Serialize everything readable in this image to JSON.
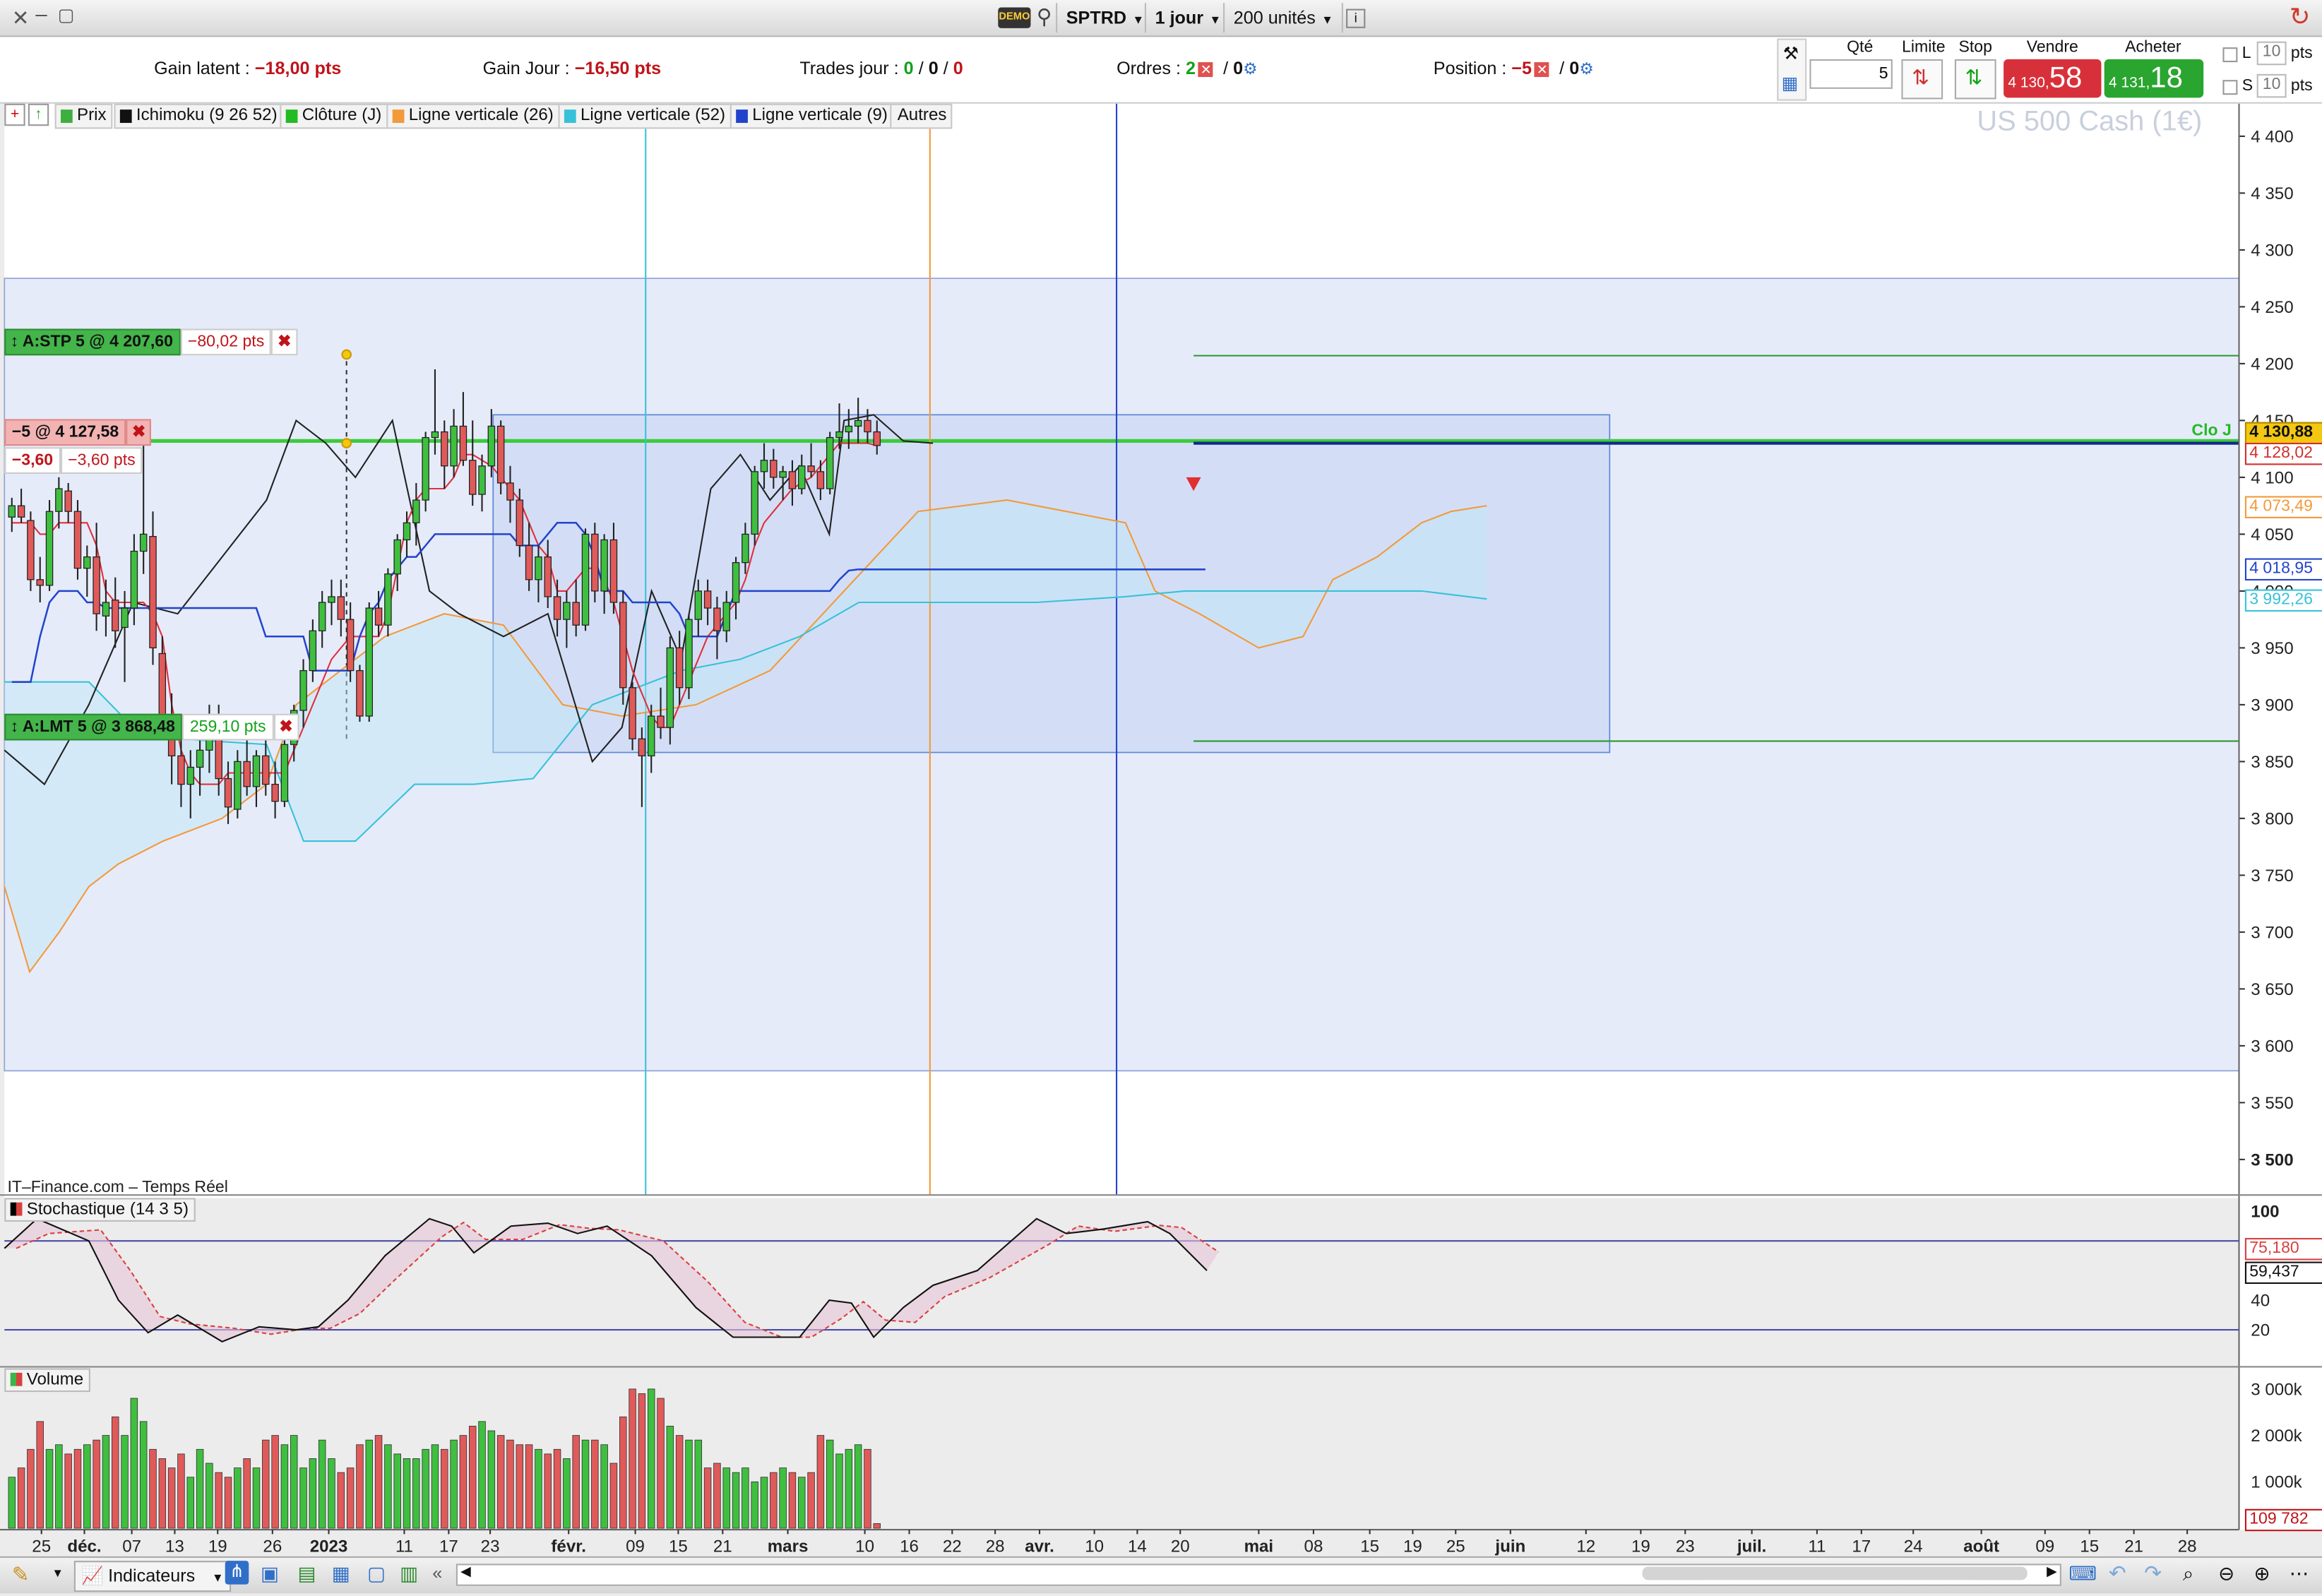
{
  "toolbar": {
    "demo_label": "DEMO",
    "symbol": "SPTRD",
    "timeframe": "1 jour",
    "units": "200 unités"
  },
  "info": {
    "gain_latent_label": "Gain latent :",
    "gain_latent_value": "−18,00 pts",
    "gain_jour_label": "Gain Jour :",
    "gain_jour_value": "−16,50 pts",
    "trades_label": "Trades jour :",
    "trades_a": "0",
    "trades_b": "0",
    "trades_c": "0",
    "ordres_label": "Ordres :",
    "ordres_a": "2",
    "ordres_b": "0",
    "position_label": "Position :",
    "position_a": "−5",
    "position_b": "0",
    "sep": "/"
  },
  "order": {
    "qty_label": "Qté",
    "qty_value": "5",
    "limit_label": "Limite",
    "stop_label": "Stop",
    "sell_label": "Vendre",
    "buy_label": "Acheter",
    "sell_small": "4 130,",
    "sell_big": "58",
    "buy_small": "4 131,",
    "buy_big": "18",
    "l_label": "L",
    "s_label": "S",
    "l_val": "10",
    "s_val": "10",
    "pts": "pts"
  },
  "legend": [
    {
      "label": "Prix",
      "color": "#3fae3f"
    },
    {
      "label": "Ichimoku (9 26 52)",
      "color": "#111111"
    },
    {
      "label": "Clôture (J)",
      "color": "#22bb22"
    },
    {
      "label": "Ligne verticale (26)",
      "color": "#f29a3a"
    },
    {
      "label": "Ligne verticale (52)",
      "color": "#37c2d8"
    },
    {
      "label": "Ligne verticale (9)",
      "color": "#2244cc"
    },
    {
      "label": "Autres",
      "color": ""
    }
  ],
  "watermark": "US 500 Cash (1€)",
  "source": "IT–Finance.com – Temps Réel",
  "flags": {
    "stp_label": "A:STP  5 @ 4 207,60",
    "stp_pts": "−80,02 pts",
    "pos_label": "−5 @ 4 127,58",
    "pos_pts1": "−3,60",
    "pos_pts2": "−3,60 pts",
    "lmt_label": "A:LMT  5 @ 3 868,48",
    "lmt_pts": "259,10 pts",
    "clo_j": "Clo J"
  },
  "price_axis": {
    "ticks": [
      "4 400",
      "4 350",
      "4 300",
      "4 250",
      "4 200",
      "4 150",
      "4 100",
      "4 050",
      "4 000",
      "3 950",
      "3 900",
      "3 850",
      "3 800",
      "3 750",
      "3 700",
      "3 650",
      "3 600",
      "3 550",
      "3 500"
    ],
    "badges": [
      {
        "text": "4 130,88",
        "bg": "#f3c712",
        "fg": "#111"
      },
      {
        "text": "4 128,02",
        "bg": "#ffffff",
        "fg": "#d03030"
      },
      {
        "text": "4 073,49",
        "bg": "#ffffff",
        "fg": "#f29a3a"
      },
      {
        "text": "4 018,95",
        "bg": "#ffffff",
        "fg": "#2244cc"
      },
      {
        "text": "3 992,26",
        "bg": "#ffffff",
        "fg": "#37c2d8"
      }
    ]
  },
  "stoch": {
    "label": "Stochastique (14 3 5)",
    "ticks": [
      "100",
      "40",
      "20"
    ],
    "badge1": "75,180",
    "badge2": "59,437"
  },
  "volume": {
    "label": "Volume",
    "ticks": [
      "3 000k",
      "2 000k",
      "1 000k"
    ],
    "badge": "109 782"
  },
  "date_axis": [
    {
      "t": "25"
    },
    {
      "t": "déc.",
      "b": true
    },
    {
      "t": "07"
    },
    {
      "t": "13"
    },
    {
      "t": "19"
    },
    {
      "t": "26"
    },
    {
      "t": "2023",
      "b": true
    },
    {
      "t": "11"
    },
    {
      "t": "17"
    },
    {
      "t": "23"
    },
    {
      "t": "févr.",
      "b": true
    },
    {
      "t": "09"
    },
    {
      "t": "15"
    },
    {
      "t": "21"
    },
    {
      "t": "mars",
      "b": true
    },
    {
      "t": "10"
    },
    {
      "t": "16"
    },
    {
      "t": "22"
    },
    {
      "t": "28"
    },
    {
      "t": "avr.",
      "b": true
    },
    {
      "t": "10"
    },
    {
      "t": "14"
    },
    {
      "t": "20"
    },
    {
      "t": "mai",
      "b": true
    },
    {
      "t": "08"
    },
    {
      "t": "15"
    },
    {
      "t": "19"
    },
    {
      "t": "25"
    },
    {
      "t": "juin",
      "b": true
    },
    {
      "t": "12"
    },
    {
      "t": "19"
    },
    {
      "t": "23"
    },
    {
      "t": "juil.",
      "b": true
    },
    {
      "t": "11"
    },
    {
      "t": "17"
    },
    {
      "t": "24"
    },
    {
      "t": "août",
      "b": true
    },
    {
      "t": "09"
    },
    {
      "t": "15"
    },
    {
      "t": "21"
    },
    {
      "t": "28"
    }
  ],
  "bottom": {
    "indicators_label": "Indicateurs"
  },
  "chart_data": {
    "type": "candlestick",
    "candles": [
      [
        4065,
        4082,
        4052,
        4075
      ],
      [
        4075,
        4090,
        4060,
        4065
      ],
      [
        4062,
        4070,
        4000,
        4010
      ],
      [
        4010,
        4030,
        3990,
        4005
      ],
      [
        4005,
        4080,
        4000,
        4070
      ],
      [
        4070,
        4100,
        4055,
        4090
      ],
      [
        4088,
        4095,
        4060,
        4070
      ],
      [
        4070,
        4080,
        4010,
        4020
      ],
      [
        4020,
        4040,
        3995,
        4030
      ],
      [
        4030,
        4060,
        3965,
        3980
      ],
      [
        3978,
        4010,
        3960,
        3990
      ],
      [
        3992,
        4012,
        3950,
        3965
      ],
      [
        3968,
        4000,
        3920,
        3985
      ],
      [
        3985,
        4050,
        3970,
        4035
      ],
      [
        4035,
        4150,
        4015,
        4050
      ],
      [
        4048,
        4070,
        3935,
        3950
      ],
      [
        3945,
        3960,
        3880,
        3890
      ],
      [
        3890,
        3910,
        3830,
        3855
      ],
      [
        3855,
        3880,
        3810,
        3830
      ],
      [
        3830,
        3860,
        3800,
        3845
      ],
      [
        3845,
        3880,
        3820,
        3860
      ],
      [
        3860,
        3900,
        3840,
        3880
      ],
      [
        3880,
        3900,
        3820,
        3835
      ],
      [
        3835,
        3850,
        3795,
        3810
      ],
      [
        3808,
        3860,
        3800,
        3850
      ],
      [
        3850,
        3870,
        3820,
        3828
      ],
      [
        3828,
        3860,
        3810,
        3855
      ],
      [
        3855,
        3880,
        3820,
        3830
      ],
      [
        3830,
        3850,
        3800,
        3815
      ],
      [
        3815,
        3870,
        3810,
        3865
      ],
      [
        3865,
        3900,
        3850,
        3895
      ],
      [
        3895,
        3940,
        3880,
        3930
      ],
      [
        3930,
        3975,
        3920,
        3965
      ],
      [
        3965,
        4000,
        3950,
        3990
      ],
      [
        3990,
        4010,
        3970,
        3995
      ],
      [
        3995,
        4010,
        3960,
        3975
      ],
      [
        3975,
        3990,
        3920,
        3930
      ],
      [
        3930,
        3935,
        3885,
        3890
      ],
      [
        3890,
        3990,
        3885,
        3985
      ],
      [
        3985,
        4000,
        3960,
        3970
      ],
      [
        3970,
        4020,
        3960,
        4015
      ],
      [
        4015,
        4050,
        4000,
        4045
      ],
      [
        4045,
        4070,
        4030,
        4060
      ],
      [
        4060,
        4095,
        4040,
        4080
      ],
      [
        4080,
        4140,
        4070,
        4135
      ],
      [
        4135,
        4195,
        4120,
        4140
      ],
      [
        4140,
        4150,
        4090,
        4110
      ],
      [
        4110,
        4160,
        4100,
        4145
      ],
      [
        4145,
        4175,
        4110,
        4115
      ],
      [
        4115,
        4150,
        4075,
        4085
      ],
      [
        4085,
        4120,
        4070,
        4110
      ],
      [
        4110,
        4160,
        4100,
        4145
      ],
      [
        4145,
        4150,
        4085,
        4095
      ],
      [
        4095,
        4110,
        4060,
        4080
      ],
      [
        4080,
        4090,
        4030,
        4040
      ],
      [
        4040,
        4060,
        4000,
        4010
      ],
      [
        4010,
        4040,
        3990,
        4030
      ],
      [
        4030,
        4045,
        3985,
        3995
      ],
      [
        3995,
        4010,
        3960,
        3975
      ],
      [
        3975,
        4000,
        3950,
        3990
      ],
      [
        3990,
        4010,
        3960,
        3970
      ],
      [
        3970,
        4055,
        3965,
        4050
      ],
      [
        4050,
        4060,
        3990,
        4000
      ],
      [
        4000,
        4050,
        3980,
        4045
      ],
      [
        4045,
        4060,
        3980,
        3990
      ],
      [
        3990,
        4000,
        3900,
        3915
      ],
      [
        3915,
        3920,
        3860,
        3870
      ],
      [
        3870,
        3880,
        3810,
        3855
      ],
      [
        3855,
        3900,
        3840,
        3890
      ],
      [
        3890,
        3915,
        3870,
        3880
      ],
      [
        3880,
        3960,
        3865,
        3950
      ],
      [
        3950,
        3965,
        3900,
        3915
      ],
      [
        3915,
        3980,
        3905,
        3975
      ],
      [
        3975,
        4010,
        3960,
        4000
      ],
      [
        4000,
        4010,
        3970,
        3985
      ],
      [
        3985,
        3995,
        3940,
        3965
      ],
      [
        3965,
        4000,
        3955,
        3990
      ],
      [
        3990,
        4030,
        3975,
        4025
      ],
      [
        4025,
        4060,
        4015,
        4050
      ],
      [
        4050,
        4110,
        4040,
        4105
      ],
      [
        4105,
        4130,
        4090,
        4115
      ],
      [
        4115,
        4125,
        4090,
        4100
      ],
      [
        4100,
        4110,
        4080,
        4105
      ],
      [
        4105,
        4115,
        4075,
        4090
      ],
      [
        4090,
        4120,
        4085,
        4110
      ],
      [
        4110,
        4130,
        4100,
        4105
      ],
      [
        4105,
        4115,
        4080,
        4090
      ],
      [
        4090,
        4140,
        4085,
        4135
      ],
      [
        4135,
        4165,
        4125,
        4140
      ],
      [
        4140,
        4160,
        4125,
        4145
      ],
      [
        4145,
        4170,
        4130,
        4150
      ],
      [
        4150,
        4160,
        4130,
        4140
      ],
      [
        4140,
        4150,
        4120,
        4128
      ]
    ],
    "volume_k": [
      1100,
      1300,
      1700,
      2300,
      1700,
      1800,
      1600,
      1700,
      1800,
      1900,
      2000,
      2400,
      2000,
      2800,
      2300,
      1700,
      1500,
      1300,
      1600,
      1100,
      1700,
      1400,
      1200,
      1100,
      1300,
      1500,
      1300,
      1900,
      2000,
      1800,
      2000,
      1300,
      1500,
      1900,
      1500,
      1200,
      1300,
      1800,
      1900,
      2000,
      1800,
      1600,
      1500,
      1500,
      1700,
      1800,
      1700,
      1900,
      2000,
      2200,
      2300,
      2100,
      2000,
      1900,
      1800,
      1800,
      1700,
      1600,
      1700,
      1500,
      2000,
      1900,
      1900,
      1800,
      1400,
      2400,
      3000,
      2900,
      3000,
      2800,
      2200,
      2000,
      1900,
      1900,
      1300,
      1400,
      1300,
      1200,
      1300,
      1000,
      1100,
      1200,
      1300,
      1200,
      1100,
      1200,
      2000,
      1900,
      1600,
      1700,
      1800,
      1700,
      100
    ],
    "tenkan": [
      4060,
      4060,
      4060,
      4050,
      4050,
      4060,
      4060,
      4060,
      4060,
      4040,
      4000,
      3990,
      3990,
      3990,
      3990,
      3980,
      3960,
      3900,
      3860,
      3840,
      3830,
      3830,
      3830,
      3840,
      3840,
      3840,
      3840,
      3840,
      3840,
      3840,
      3860,
      3880,
      3900,
      3920,
      3940,
      3950,
      3960,
      3960,
      3960,
      3960,
      3980,
      4020,
      4060,
      4080,
      4090,
      4090,
      4090,
      4100,
      4120,
      4120,
      4115,
      4110,
      4100,
      4090,
      4080,
      4060,
      4040,
      4030,
      4000,
      4000,
      4010,
      4020,
      4020,
      4010,
      3990,
      3960,
      3930,
      3910,
      3890,
      3880,
      3880,
      3900,
      3920,
      3940,
      3960,
      3970,
      3980,
      3990,
      4010,
      4040,
      4060,
      4070,
      4080,
      4090,
      4095,
      4100,
      4110,
      4120,
      4130,
      4130,
      4130,
      4130,
      4128
    ],
    "kijun": [
      3920,
      3920,
      3920,
      3960,
      3990,
      4000,
      4000,
      4000,
      3990,
      3990,
      3985,
      3985,
      3985,
      3985,
      3985,
      3985,
      3985,
      3985,
      3985,
      3985,
      3985,
      3985,
      3985,
      3985,
      3985,
      3985,
      3985,
      3960,
      3960,
      3960,
      3960,
      3960,
      3930,
      3930,
      3930,
      3930,
      3930,
      3960,
      3980,
      3990,
      4010,
      4020,
      4030,
      4030,
      4040,
      4050,
      4050,
      4050,
      4050,
      4050,
      4050,
      4050,
      4050,
      4050,
      4040,
      4040,
      4040,
      4050,
      4060,
      4060,
      4060,
      4050,
      4030,
      4000,
      4000,
      4000,
      3990,
      3990,
      3990,
      3990,
      3990,
      3980,
      3960,
      3960,
      3960,
      3960,
      3980,
      4000,
      4000,
      4000,
      4000,
      4000,
      4000,
      4000,
      4000,
      4000,
      4000,
      4000,
      4010,
      4018,
      4019
    ]
  }
}
